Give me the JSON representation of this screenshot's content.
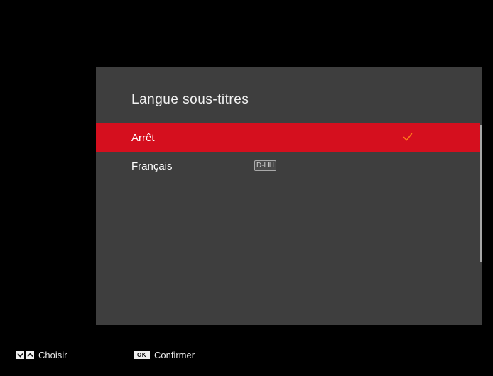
{
  "dialog": {
    "title": "Langue sous-titres",
    "options": [
      {
        "label": "Arrêt",
        "selected": true,
        "checked": true,
        "badge": ""
      },
      {
        "label": "Français",
        "selected": false,
        "checked": false,
        "badge": "D-HH"
      }
    ]
  },
  "footer": {
    "choose_label": "Choisir",
    "ok_key_label": "OK",
    "confirm_label": "Confirmer"
  },
  "colors": {
    "highlight": "#d50f1e",
    "check": "#ff7a1a",
    "dialog_bg": "#3e3e3e"
  },
  "icons": {
    "check": "check-icon",
    "down": "chevron-down-icon",
    "up": "chevron-up-icon"
  }
}
